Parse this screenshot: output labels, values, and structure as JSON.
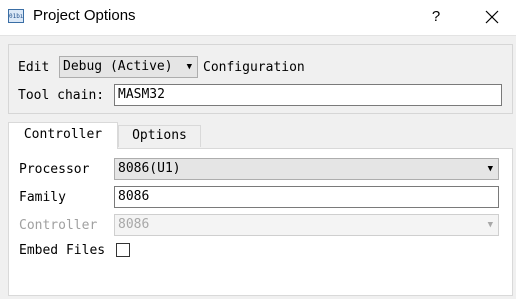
{
  "window": {
    "icon_text": "01bı",
    "title": "Project Options",
    "help_label": "?"
  },
  "config": {
    "edit_label": "Edit",
    "build_config_value": "Debug (Active)",
    "configuration_label": "Configuration",
    "tool_chain_label": "Tool chain:",
    "tool_chain_value": "MASM32"
  },
  "tabs": [
    {
      "label": "Controller",
      "active": true
    },
    {
      "label": "Options",
      "active": false
    }
  ],
  "controller": {
    "processor_label": "Processor",
    "processor_value": "8086(U1)",
    "family_label": "Family",
    "family_value": "8086",
    "controller_label": "Controller",
    "controller_value": "8086",
    "embed_files_label": "Embed Files",
    "embed_files_checked": false
  },
  "colors": {
    "annotation_underline": "#e8001c",
    "window_bg": "#f0f0f0",
    "panel_bg": "#ffffff"
  },
  "icons": [
    "app-icon",
    "help-icon",
    "close-icon",
    "dropdown-arrow-icon"
  ]
}
